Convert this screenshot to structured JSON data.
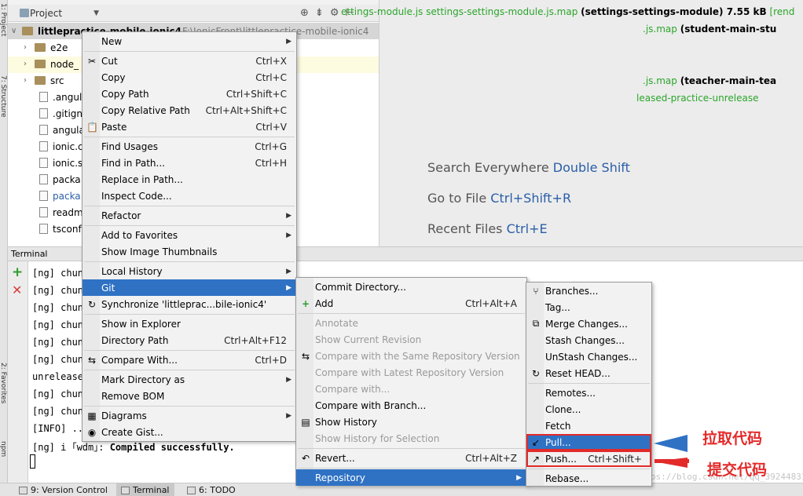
{
  "left_strip": {
    "project_tab": "1: Project",
    "structure_tab": "7: Structure",
    "favorites_tab": "2: Favorites",
    "npm_tab": "npm"
  },
  "project_panel": {
    "title": "Project",
    "root_name": "littlepractice-mobile-ionic4",
    "root_path": "F:\\IonicFront\\littlepractice-mobile-ionic4",
    "items": [
      {
        "label": "e2e",
        "type": "folder"
      },
      {
        "label": "node_",
        "type": "folder"
      },
      {
        "label": "src",
        "type": "folder"
      },
      {
        "label": ".angul",
        "type": "file"
      },
      {
        "label": ".gitign",
        "type": "file"
      },
      {
        "label": "angula",
        "type": "file"
      },
      {
        "label": "ionic.c",
        "type": "file"
      },
      {
        "label": "ionic.s",
        "type": "file"
      },
      {
        "label": "packa",
        "type": "file"
      },
      {
        "label": "packa",
        "type": "file",
        "color": "#2a5ea8"
      },
      {
        "label": "readm",
        "type": "file"
      },
      {
        "label": "tsconf",
        "type": "file"
      }
    ]
  },
  "editor_hints": [
    {
      "text": "Search Everywhere",
      "key": "Double Shift"
    },
    {
      "text": "Go to File",
      "key": "Ctrl+Shift+R"
    },
    {
      "text": "Recent Files",
      "key": "Ctrl+E"
    }
  ],
  "terminal": {
    "title": "Terminal",
    "lines": [
      {
        "a": "[ng] chun",
        "b": "ettings-module.js settings-settings-module.js.map",
        "c": "(settings-settings-module) 7.55 kB",
        "d": "[rend"
      },
      {
        "a": "[ng] chun",
        "b": ".js.map",
        "c": "(student-main-stu",
        "d": ""
      },
      {
        "a": "[ng] chun",
        "b": "",
        "c": "",
        "d": ""
      },
      {
        "a": "[ng] chun",
        "b": "",
        "c": "",
        "d": ""
      },
      {
        "a": "[ng] chun",
        "b": ".js.map",
        "c": "(teacher-main-tea",
        "d": ""
      },
      {
        "a": "[ng] chun",
        "b": "leased-practice-unrelease",
        "c": "",
        "d": ""
      },
      {
        "a": "unrelease",
        "b": "",
        "c": "",
        "d": ""
      },
      {
        "a": "[ng] chun",
        "b": "",
        "c": "",
        "d": ""
      },
      {
        "a": "[ng] chun",
        "b": "",
        "c": "",
        "d": ""
      },
      {
        "a": "[INFO] ..",
        "b": "",
        "c": "",
        "d": ""
      },
      {
        "a": "[ng] i ｢wdm｣: ",
        "b": "",
        "c": "Compiled successfully.",
        "d": ""
      }
    ]
  },
  "statusbar": {
    "version_control": "9: Version Control",
    "terminal": "Terminal",
    "todo": "6: TODO",
    "watermark": "https://blog.csdn.net/qq_39244831"
  },
  "context_menu": [
    {
      "label": "New",
      "shortcut": "",
      "submenu": true,
      "icon": ""
    },
    {
      "sep": true
    },
    {
      "label": "Cut",
      "shortcut": "Ctrl+X",
      "icon": "✂",
      "icon_name": "scissors-icon"
    },
    {
      "label": "Copy",
      "shortcut": "Ctrl+C",
      "icon": "",
      "icon_name": ""
    },
    {
      "label": "Copy Path",
      "shortcut": "Ctrl+Shift+C",
      "icon": ""
    },
    {
      "label": "Copy Relative Path",
      "shortcut": "Ctrl+Alt+Shift+C",
      "icon": ""
    },
    {
      "label": "Paste",
      "shortcut": "Ctrl+V",
      "icon": "📋",
      "icon_name": "clipboard-icon"
    },
    {
      "sep": true
    },
    {
      "label": "Find Usages",
      "shortcut": "Ctrl+G",
      "icon": ""
    },
    {
      "label": "Find in Path...",
      "shortcut": "Ctrl+H",
      "icon": ""
    },
    {
      "label": "Replace in Path...",
      "shortcut": "",
      "icon": ""
    },
    {
      "label": "Inspect Code...",
      "shortcut": "",
      "icon": ""
    },
    {
      "sep": true
    },
    {
      "label": "Refactor",
      "shortcut": "",
      "submenu": true,
      "icon": ""
    },
    {
      "sep": true
    },
    {
      "label": "Add to Favorites",
      "shortcut": "",
      "submenu": true,
      "icon": ""
    },
    {
      "label": "Show Image Thumbnails",
      "shortcut": "",
      "icon": ""
    },
    {
      "sep": true
    },
    {
      "label": "Local History",
      "shortcut": "",
      "submenu": true,
      "icon": ""
    },
    {
      "label": "Git",
      "shortcut": "",
      "submenu": true,
      "active": true,
      "icon": ""
    },
    {
      "label": "Synchronize 'littleprac...bile-ionic4'",
      "shortcut": "",
      "icon": "↻",
      "icon_name": "sync-icon"
    },
    {
      "sep": true
    },
    {
      "label": "Show in Explorer",
      "shortcut": "",
      "icon": ""
    },
    {
      "label": "Directory Path",
      "shortcut": "Ctrl+Alt+F12",
      "icon": ""
    },
    {
      "sep": true
    },
    {
      "label": "Compare With...",
      "shortcut": "Ctrl+D",
      "icon": "⇆",
      "icon_name": "compare-icon"
    },
    {
      "sep": true
    },
    {
      "label": "Mark Directory as",
      "shortcut": "",
      "submenu": true,
      "icon": ""
    },
    {
      "label": "Remove BOM",
      "shortcut": "",
      "icon": ""
    },
    {
      "sep": true
    },
    {
      "label": "Diagrams",
      "shortcut": "",
      "submenu": true,
      "icon": "▦",
      "icon_name": "diagram-icon"
    },
    {
      "label": "Create Gist...",
      "shortcut": "",
      "icon": "◉",
      "icon_name": "github-icon"
    }
  ],
  "git_menu": [
    {
      "label": "Commit Directory...",
      "shortcut": "",
      "icon": ""
    },
    {
      "label": "Add",
      "shortcut": "Ctrl+Alt+A",
      "icon": "+",
      "icon_name": "add-icon"
    },
    {
      "sep": true
    },
    {
      "label": "Annotate",
      "shortcut": "",
      "disabled": true,
      "icon": ""
    },
    {
      "label": "Show Current Revision",
      "shortcut": "",
      "disabled": true,
      "icon": ""
    },
    {
      "label": "Compare with the Same Repository Version",
      "shortcut": "",
      "disabled": true,
      "icon": "⇆",
      "icon_name": "compare-icon"
    },
    {
      "label": "Compare with Latest Repository Version",
      "shortcut": "",
      "disabled": true,
      "icon": ""
    },
    {
      "label": "Compare with...",
      "shortcut": "",
      "disabled": true,
      "icon": ""
    },
    {
      "label": "Compare with Branch...",
      "shortcut": "",
      "icon": ""
    },
    {
      "label": "Show History",
      "shortcut": "",
      "icon": "▤",
      "icon_name": "history-icon"
    },
    {
      "label": "Show History for Selection",
      "shortcut": "",
      "disabled": true,
      "icon": ""
    },
    {
      "sep": true
    },
    {
      "label": "Revert...",
      "shortcut": "Ctrl+Alt+Z",
      "icon": "↶",
      "icon_name": "revert-icon"
    },
    {
      "sep": true
    },
    {
      "label": "Repository",
      "shortcut": "",
      "submenu": true,
      "active": true,
      "icon": ""
    }
  ],
  "repo_menu": [
    {
      "label": "Branches...",
      "shortcut": "",
      "icon": "⑂",
      "icon_name": "branch-icon"
    },
    {
      "label": "Tag...",
      "shortcut": "",
      "icon": ""
    },
    {
      "label": "Merge Changes...",
      "shortcut": "",
      "icon": "⧉",
      "icon_name": "merge-icon"
    },
    {
      "label": "Stash Changes...",
      "shortcut": "",
      "icon": ""
    },
    {
      "label": "UnStash Changes...",
      "shortcut": "",
      "icon": ""
    },
    {
      "label": "Reset HEAD...",
      "shortcut": "",
      "icon": "↻",
      "icon_name": "reset-icon"
    },
    {
      "sep": true
    },
    {
      "label": "Remotes...",
      "shortcut": "",
      "icon": ""
    },
    {
      "label": "Clone...",
      "shortcut": "",
      "icon": ""
    },
    {
      "label": "Fetch",
      "shortcut": "",
      "icon": ""
    },
    {
      "label": "Pull...",
      "shortcut": "",
      "icon": "↙",
      "icon_name": "pull-icon",
      "state": "selected-boxed"
    },
    {
      "label": "Push...",
      "shortcut": "Ctrl+Shift+",
      "icon": "↗",
      "icon_name": "push-icon",
      "state": "boxed"
    },
    {
      "sep": true
    },
    {
      "label": "Rebase...",
      "shortcut": "",
      "icon": ""
    }
  ],
  "annotations": {
    "pull_note": "拉取代码",
    "push_note": "提交代码",
    "color": "#e32a2a"
  }
}
